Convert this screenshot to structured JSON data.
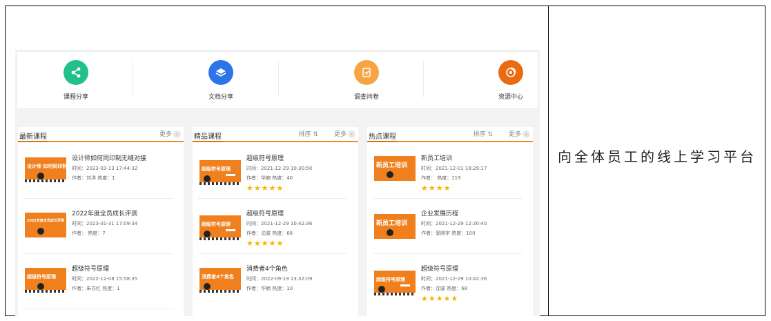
{
  "side_text": "向全体员工的线上学习平台",
  "quick_links": [
    {
      "label": "课程分享",
      "icon": "share-icon",
      "color": "#22c08a"
    },
    {
      "label": "文档分享",
      "icon": "layers-icon",
      "color": "#2d74e8"
    },
    {
      "label": "调查问卷",
      "icon": "survey-icon",
      "color": "#f7a543"
    },
    {
      "label": "资源中心",
      "icon": "resource-icon",
      "color": "#ea6b12"
    }
  ],
  "columns": [
    {
      "title": "最新课程",
      "more": "更多",
      "sort": "",
      "items": [
        {
          "name": "设计师如何同印制无缝对接",
          "time": "时间：2023-03-13 17:44:32",
          "info": "作者：刘洋  热度：1",
          "thumb": "设计师 如何同印制无缝对接",
          "stars": ""
        },
        {
          "name": "2022年度全员成长评测",
          "time": "时间：2023-01-31 17:09:34",
          "info": "作者：  热度：7",
          "thumb": "2022年度全员成长评测",
          "stars": ""
        },
        {
          "name": "超级符号原理",
          "time": "时间：2022-12-08 15:58:35",
          "info": "作者：朱亦红  热度：1",
          "thumb": "超级符号原理",
          "stars": ""
        }
      ]
    },
    {
      "title": "精品课程",
      "more": "更多",
      "sort": "排序",
      "items": [
        {
          "name": "超级符号原理",
          "time": "时间：2021-12-29 10:30:50",
          "info": "作者：华楠  热度：40",
          "thumb": "超级符号原理",
          "stars": "★★★★★"
        },
        {
          "name": "超级符号原理",
          "time": "时间：2021-12-29 10:42:36",
          "info": "作者：沈骏  热度：68",
          "thumb": "超级符号原理",
          "stars": "★★★★★"
        },
        {
          "name": "消费者4个角色",
          "time": "时间：2022-09-19 13:32:09",
          "info": "作者：华楠  热度：10",
          "thumb": "消费者4个角色",
          "stars": ""
        }
      ]
    },
    {
      "title": "热点课程",
      "more": "更多",
      "sort": "排序",
      "items": [
        {
          "name": "新员工培训",
          "time": "时间：2021-12-01 18:29:17",
          "info": "作者：  热度：119",
          "thumb": "新员工培训",
          "stars": "★★★★"
        },
        {
          "name": "企业发展历程",
          "time": "时间：2021-12-29 12:30:40",
          "info": "作者：郭晓宇  热度：100",
          "thumb": "新员工培训",
          "stars": ""
        },
        {
          "name": "超级符号原理",
          "time": "时间：2021-12-29 10:42:36",
          "info": "作者：沈骏  热度：68",
          "thumb": "超级符号原理",
          "stars": "★★★★★"
        }
      ]
    }
  ]
}
